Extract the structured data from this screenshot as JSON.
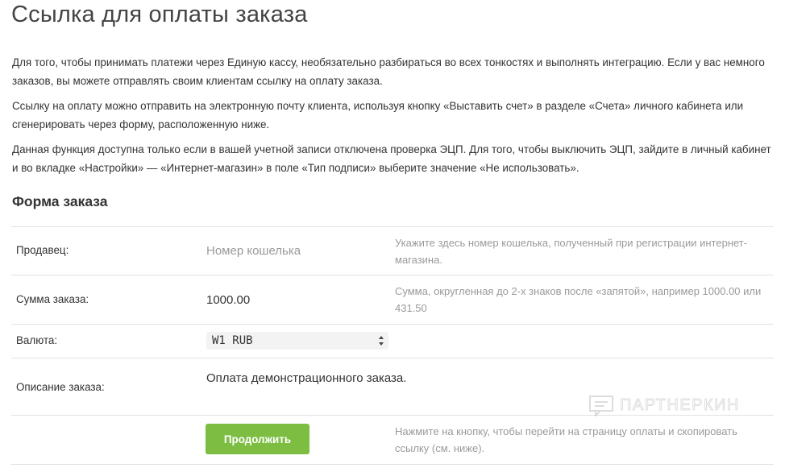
{
  "page": {
    "title": "Ссылка для оплаты заказа",
    "paragraphs": [
      "Для того, чтобы принимать платежи через Единую кассу, необязательно разбираться во всех тонкостях и выполнять интеграцию. Если у вас немного заказов, вы можете отправлять своим клиентам ссылку на оплату заказа.",
      "Ссылку на оплату можно отправить на электронную почту клиента, используя кнопку «Выставить счет» в разделе «Счета» личного кабинета или сгенерировать через форму, расположенную ниже.",
      "Данная функция доступна только если в вашей учетной записи отключена проверка ЭЦП. Для того, чтобы выключить ЭЦП, зайдите в личный кабинет и во вкладке «Настройки» — «Интернет-магазин» в поле «Тип подписи» выберите значение «Не использовать»."
    ]
  },
  "form": {
    "heading": "Форма заказа",
    "seller": {
      "label": "Продавец:",
      "placeholder": "Номер кошелька",
      "value": "",
      "hint": "Укажите здесь номер кошелька, полученный при регистрации интернет-магазина."
    },
    "amount": {
      "label": "Сумма заказа:",
      "value": "1000.00",
      "hint": "Сумма, округленная до 2-х знаков после «запятой», например 1000.00 или 431.50"
    },
    "currency": {
      "label": "Валюта:",
      "selected": "W1 RUB"
    },
    "description": {
      "label": "Описание заказа:",
      "value": "Оплата демонстрационного заказа."
    },
    "submit": {
      "label": "Продолжить",
      "hint": "Нажмите на кнопку, чтобы перейти на страницу оплаты и скопировать ссылку (см. ниже)."
    }
  },
  "watermark": {
    "text": "ПАРТНЕРКИН",
    "icon": "partnerkin-logo-icon"
  },
  "colors": {
    "button": "#7cbd42",
    "hint_text": "#9a9a9a",
    "divider": "#e2e2e2",
    "select_bg": "#f3f3f3"
  }
}
